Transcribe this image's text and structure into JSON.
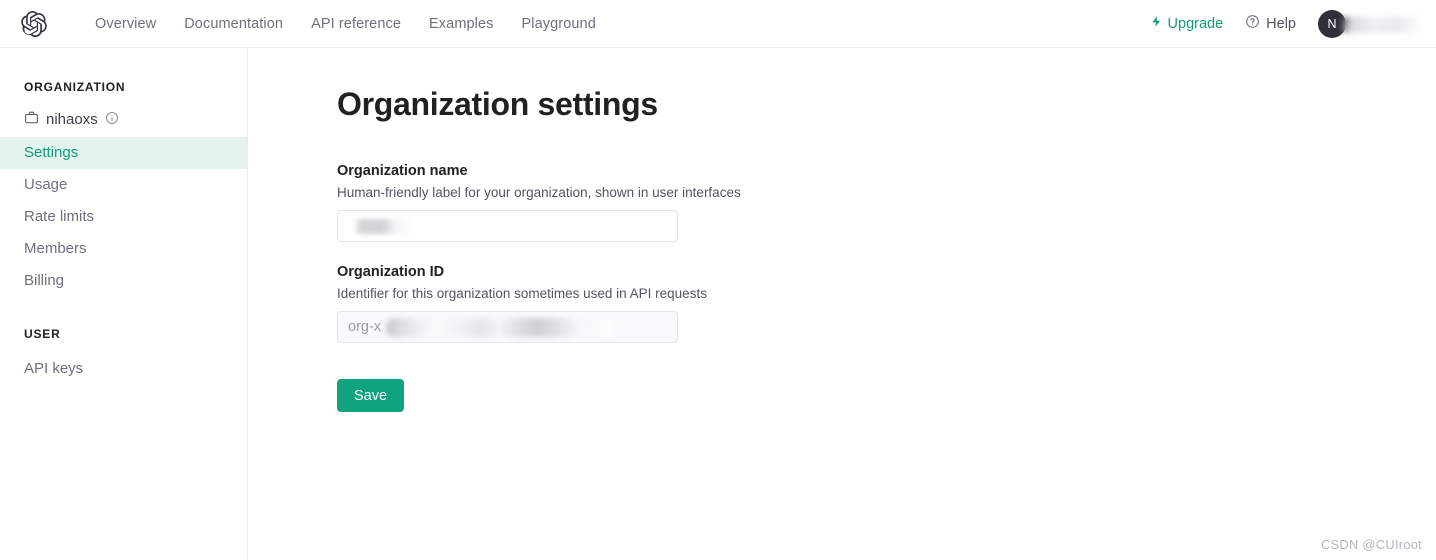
{
  "topbar": {
    "logo_alt": "OpenAI logo",
    "nav": [
      {
        "label": "Overview"
      },
      {
        "label": "Documentation"
      },
      {
        "label": "API reference"
      },
      {
        "label": "Examples"
      },
      {
        "label": "Playground"
      }
    ],
    "upgrade_label": "Upgrade",
    "help_label": "Help",
    "avatar_initial": "N",
    "accent_color": "#10a37f",
    "upgrade_color": "#0f9d77"
  },
  "sidebar": {
    "org_heading": "ORGANIZATION",
    "org_name": "nihaoxs",
    "items": [
      {
        "label": "Settings",
        "active": true
      },
      {
        "label": "Usage",
        "active": false
      },
      {
        "label": "Rate limits",
        "active": false
      },
      {
        "label": "Members",
        "active": false
      },
      {
        "label": "Billing",
        "active": false
      }
    ],
    "user_heading": "USER",
    "user_items": [
      {
        "label": "API keys",
        "active": false
      }
    ],
    "active_bg": "#e4f3ee",
    "active_color": "#0f9d77"
  },
  "main": {
    "page_title": "Organization settings",
    "org_name_field": {
      "label": "Organization name",
      "description": "Human-friendly label for your organization, shown in user interfaces",
      "value": "",
      "placeholder": ""
    },
    "org_id_field": {
      "label": "Organization ID",
      "description": "Identifier for this organization sometimes used in API requests",
      "value": "org-x",
      "placeholder": ""
    },
    "save_label": "Save"
  },
  "watermark": "CSDN @CUIroot"
}
